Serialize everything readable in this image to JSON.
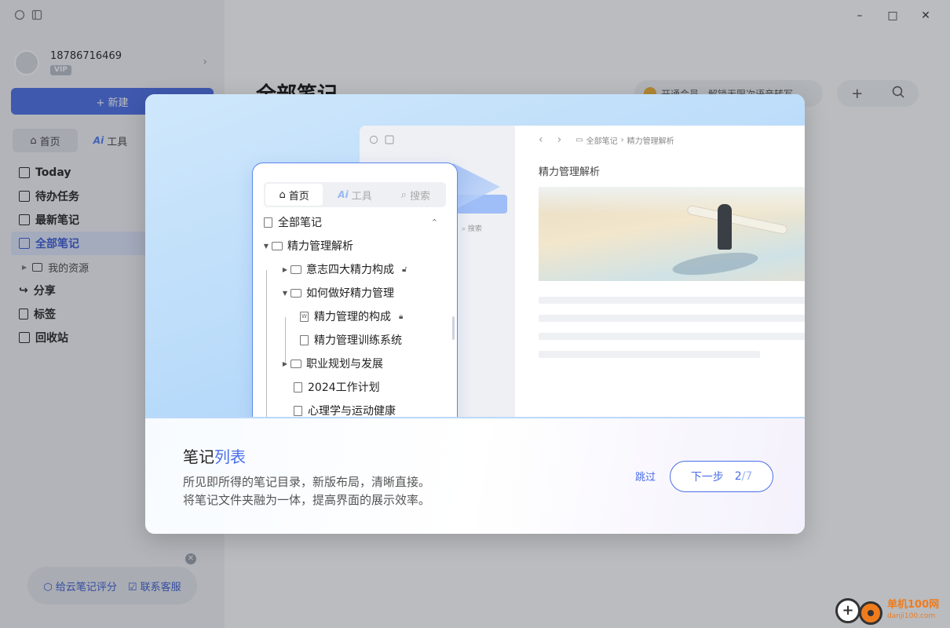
{
  "app": {
    "user": {
      "phone": "18786716469",
      "badge": "VIP"
    },
    "new_button": "+ 新建",
    "sidebar_tabs": [
      {
        "label": "首页",
        "icon": "home-icon"
      },
      {
        "label": "工具",
        "icon": "ai-icon",
        "ai_prefix": "Ai"
      }
    ],
    "nav": [
      {
        "label": "Today",
        "icon": "calendar-icon"
      },
      {
        "label": "待办任务",
        "icon": "checkbox-icon"
      },
      {
        "label": "最新笔记",
        "icon": "grid-icon"
      },
      {
        "label": "全部笔记",
        "icon": "note-icon",
        "selected": true
      },
      {
        "label": "我的资源",
        "icon": "folder-icon",
        "sub": true
      },
      {
        "label": "分享",
        "icon": "share-icon"
      },
      {
        "label": "标签",
        "icon": "bookmark-icon"
      },
      {
        "label": "回收站",
        "icon": "trash-icon"
      }
    ],
    "footer": {
      "rate": "给云笔记评分",
      "support": "联系客服"
    },
    "page_title": "全部笔记",
    "promo_text": "开通会员，解锁无限次语音转写",
    "window": {
      "minimize": "–",
      "maximize": "□",
      "close": "✕"
    }
  },
  "modal": {
    "mock": {
      "tabs": [
        {
          "label": "首页",
          "icon": "home-icon"
        },
        {
          "label": "工具",
          "icon": "ai-icon",
          "ai_prefix": "Ai"
        },
        {
          "label": "搜索",
          "icon": "search-icon"
        }
      ],
      "tree": [
        {
          "label": "全部笔记",
          "level": 0,
          "kind": "doc",
          "caret": "up"
        },
        {
          "label": "精力管理解析",
          "level": 0,
          "kind": "folder",
          "caret": "down"
        },
        {
          "label": "意志四大精力构成",
          "level": 1,
          "kind": "folder",
          "caret": "right",
          "locked": true
        },
        {
          "label": "如何做好精力管理",
          "level": 1,
          "kind": "folder",
          "caret": "down"
        },
        {
          "label": "精力管理的构成",
          "level": 2,
          "kind": "word-doc",
          "locked": true
        },
        {
          "label": "精力管理训练系统",
          "level": 2,
          "kind": "doc"
        },
        {
          "label": "职业规划与发展",
          "level": 1,
          "kind": "folder",
          "caret": "right"
        },
        {
          "label": "2024工作计划",
          "level": 1,
          "kind": "audio-doc"
        },
        {
          "label": "心理学与运动健康",
          "level": 1,
          "kind": "image-doc"
        }
      ],
      "back_breadcrumb": [
        "全部笔记",
        "精力管理解析"
      ],
      "back_title": "精力管理解析",
      "back_search": "搜索"
    },
    "title_plain": "笔记",
    "title_highlight": "列表",
    "desc_line1": "所见即所得的笔记目录，新版布局，清晰直接。",
    "desc_line2": "将笔记文件夹融为一体，提高界面的展示效率。",
    "skip": "跳过",
    "next_label": "下一步",
    "step_current": "2",
    "step_total": "/7"
  },
  "watermark": {
    "text": "单机100网",
    "url": "danji100.com"
  },
  "colors": {
    "accent": "#4a6ee8",
    "overlay": "rgba(40,46,56,0.32)",
    "hero": "#b9dbfa"
  }
}
